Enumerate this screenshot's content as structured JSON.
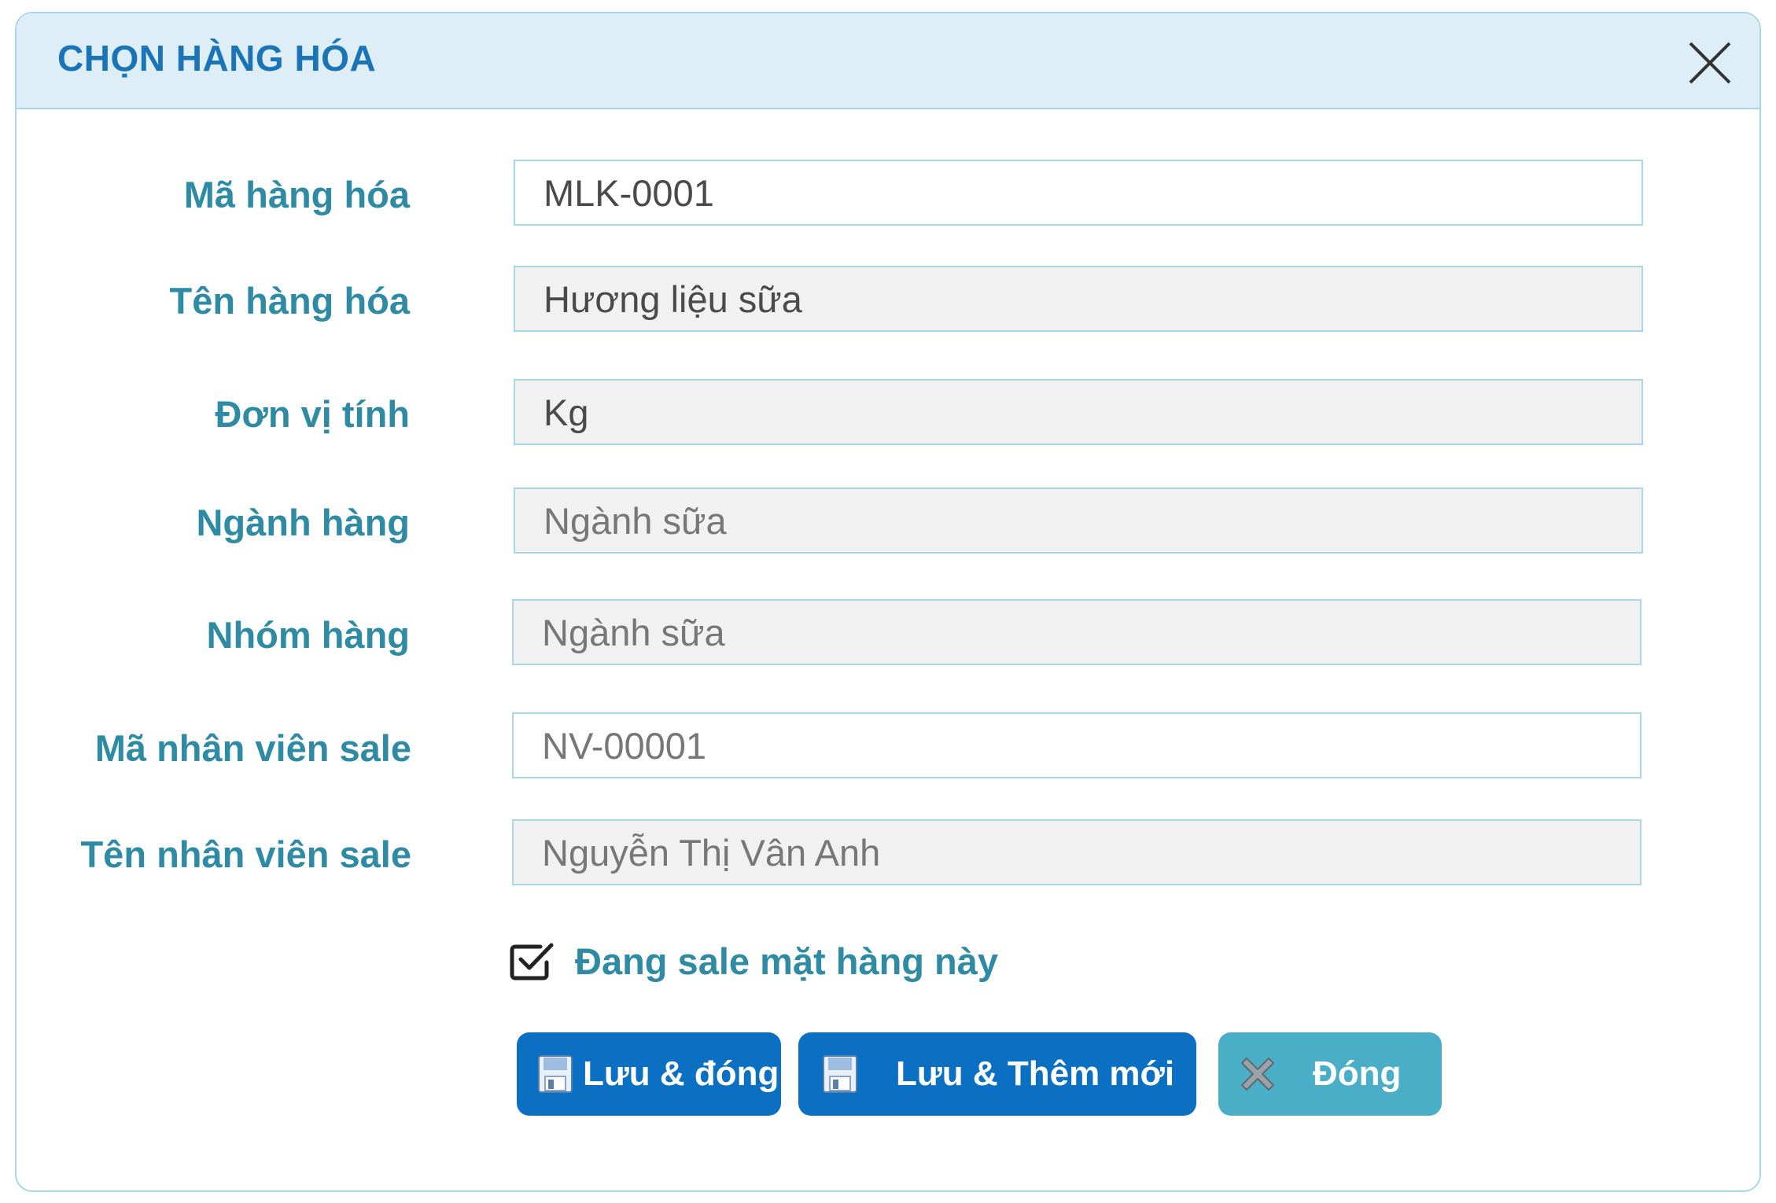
{
  "dialog": {
    "title": "CHỌN HÀNG HÓA",
    "close_icon": "close-icon"
  },
  "form": {
    "fields": [
      {
        "label": "Mã hàng hóa",
        "value": "MLK-0001"
      },
      {
        "label": "Tên hàng hóa",
        "value": "Hương liệu sữa"
      },
      {
        "label": "Đơn vị tính",
        "value": "Kg"
      },
      {
        "label": "Ngành hàng",
        "value": "Ngành sữa"
      },
      {
        "label": "Nhóm hàng",
        "value": "Ngành sữa"
      },
      {
        "label": "Mã nhân viên sale",
        "value": "NV-00001"
      },
      {
        "label": "Tên nhân viên sale",
        "value": "Nguyễn Thị Vân Anh"
      }
    ],
    "sale_checkbox": {
      "label": "Đang sale mặt hàng này",
      "checked": true
    }
  },
  "buttons": {
    "save_close": "Lưu & đóng",
    "save_new": "Lưu & Thêm mới",
    "close": "Đóng"
  },
  "colors": {
    "title": "#1b74b6",
    "label": "#2f8aa4",
    "header_bg": "#ddeef6",
    "border": "#a9d6e8",
    "primary_button": "#0b6fc2",
    "close_button": "#4aaec7"
  }
}
